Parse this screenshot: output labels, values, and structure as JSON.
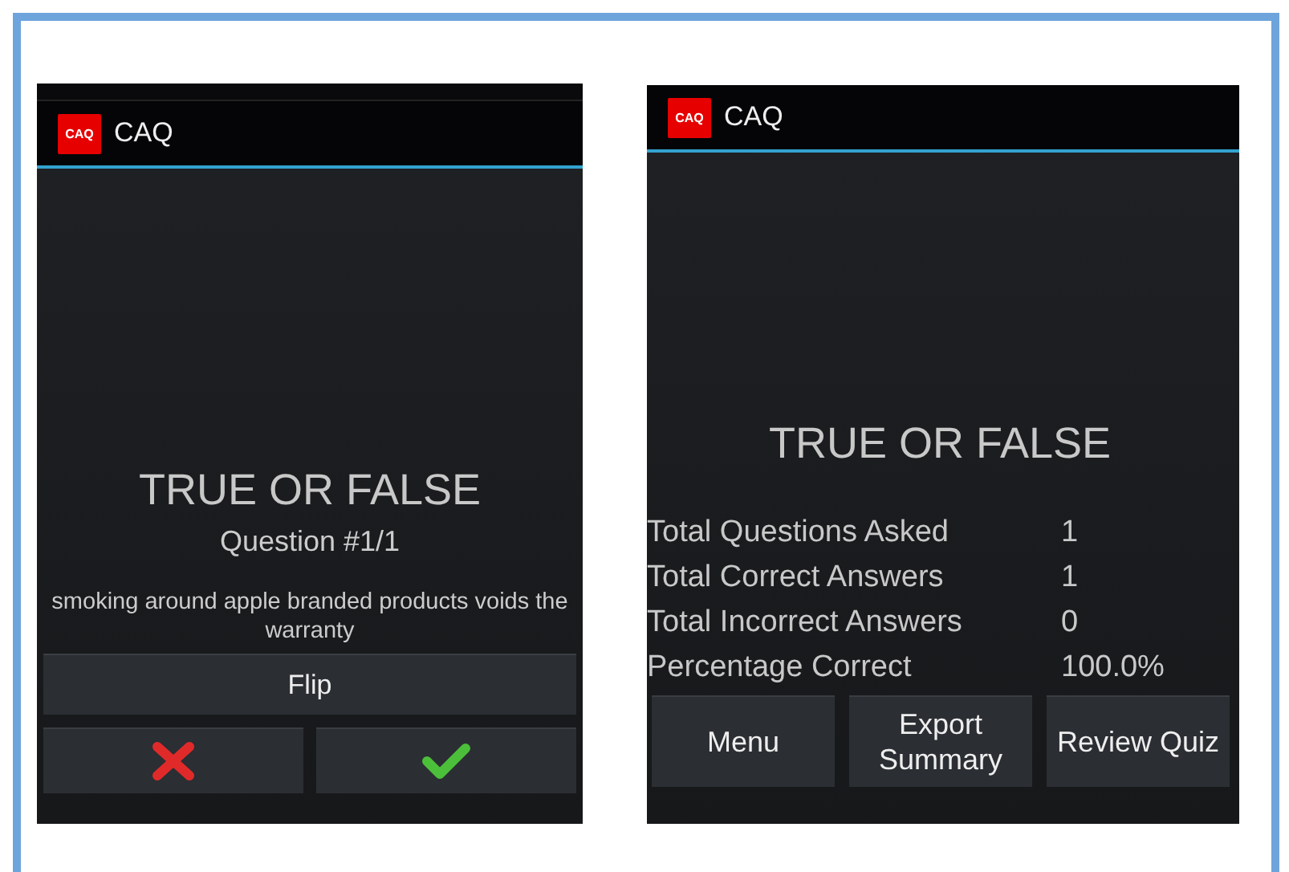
{
  "quiz_screen": {
    "app_bar": {
      "logo": "CAQ",
      "title": "CAQ"
    },
    "heading": "TRUE OR FALSE",
    "question_number": "Question #1/1",
    "question": "smoking around apple branded products voids the warranty",
    "flip_button": "Flip"
  },
  "summary_screen": {
    "app_bar": {
      "logo": "CAQ",
      "title": "CAQ"
    },
    "heading": "TRUE OR FALSE",
    "stats": [
      {
        "label": "Total Questions Asked",
        "value": "1"
      },
      {
        "label": "Total Correct Answers",
        "value": "1"
      },
      {
        "label": "Total Incorrect Answers",
        "value": "0"
      },
      {
        "label": "Percentage Correct",
        "value": "100.0%"
      }
    ],
    "buttons": [
      "Menu",
      "Export Summary",
      "Review Quiz"
    ]
  }
}
